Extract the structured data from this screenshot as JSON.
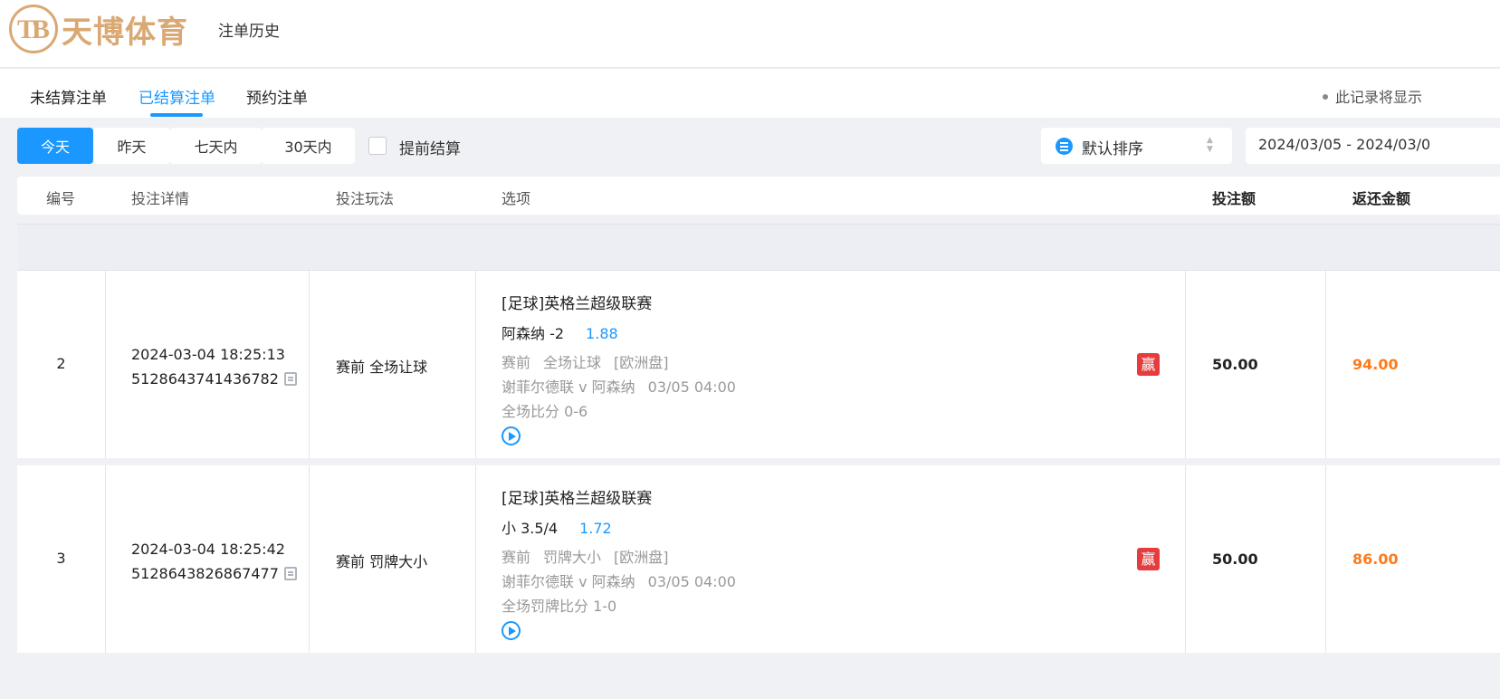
{
  "header": {
    "logo_text": "天博体育",
    "nav_title": "注单历史"
  },
  "tabs": [
    {
      "label": "未结算注单",
      "active": false
    },
    {
      "label": "已结算注单",
      "active": true
    },
    {
      "label": "预约注单",
      "active": false
    }
  ],
  "notice": "此记录将显示",
  "filters": {
    "ranges": [
      "今天",
      "昨天",
      "七天内",
      "30天内"
    ],
    "active_range": "今天",
    "early_settle_label": "提前结算",
    "early_settle_checked": false,
    "sort_label": "默认排序",
    "date_range": "2024/03/05 - 2024/03/0"
  },
  "columns": {
    "no": "编号",
    "detail": "投注详情",
    "play": "投注玩法",
    "selection": "选项",
    "stake": "投注额",
    "return": "返还金额"
  },
  "rows": [
    {
      "no": "2",
      "time": "2024-03-04 18:25:13",
      "order_id": "5128643741436782",
      "play": "赛前 全场让球",
      "league": "[足球]英格兰超级联赛",
      "pick": "阿森纳 -2",
      "odds": "1.88",
      "stage": "赛前",
      "market": "全场让球",
      "odds_type": "[欧洲盘]",
      "match": "谢菲尔德联 v 阿森纳",
      "kickoff": "03/05 04:00",
      "score": "全场比分 0-6",
      "result": "赢",
      "stake": "50.00",
      "return": "94.00"
    },
    {
      "no": "3",
      "time": "2024-03-04 18:25:42",
      "order_id": "5128643826867477",
      "play": "赛前 罚牌大小",
      "league": "[足球]英格兰超级联赛",
      "pick": "小 3.5/4",
      "odds": "1.72",
      "stage": "赛前",
      "market": "罚牌大小",
      "odds_type": "[欧洲盘]",
      "match": "谢菲尔德联 v 阿森纳",
      "kickoff": "03/05 04:00",
      "score": "全场罚牌比分 1-0",
      "result": "赢",
      "stake": "50.00",
      "return": "86.00"
    }
  ],
  "colors": {
    "accent": "#1a98ff",
    "win": "#e53d3d",
    "return": "#ff7a1a",
    "brand": "#d9a873"
  }
}
